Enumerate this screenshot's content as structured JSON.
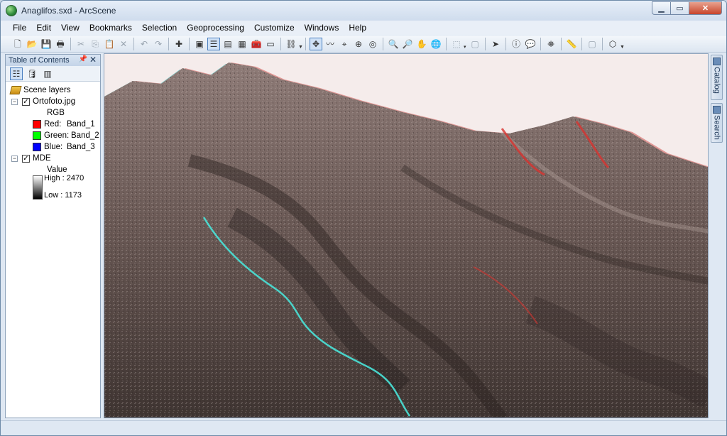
{
  "window": {
    "title": "Anaglifos.sxd - ArcScene"
  },
  "menu": [
    "File",
    "Edit",
    "View",
    "Bookmarks",
    "Selection",
    "Geoprocessing",
    "Customize",
    "Windows",
    "Help"
  ],
  "toc": {
    "title": "Table of Contents",
    "root_label": "Scene layers",
    "layers": [
      {
        "name": "Ortofoto.jpg",
        "checked": true,
        "renderer_label": "RGB",
        "bands": [
          {
            "channel": "Red:",
            "band": "Band_1",
            "color": "#ff0000"
          },
          {
            "channel": "Green:",
            "band": "Band_2",
            "color": "#00ff00"
          },
          {
            "channel": "Blue:",
            "band": "Band_3",
            "color": "#0000ff"
          }
        ]
      },
      {
        "name": "MDE",
        "checked": true,
        "value_label": "Value",
        "high_label": "High : 2470",
        "low_label": "Low : 1173"
      }
    ]
  },
  "dock_tabs": [
    "Catalog",
    "Search"
  ],
  "colors": {
    "window_frame": "#dfe8f3",
    "scene_background": "#f5eceb",
    "anaglyph_red": "#e0302e",
    "anaglyph_cyan": "#27c9c4"
  }
}
